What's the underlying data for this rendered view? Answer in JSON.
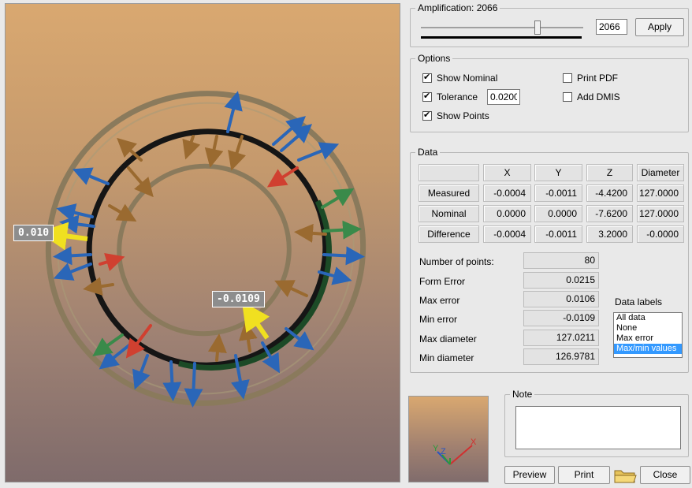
{
  "viewport": {
    "label_left": "0.010",
    "label_right": "-0.0109"
  },
  "amplification": {
    "title": "Amplification: 2066",
    "value": "2066",
    "apply_label": "Apply"
  },
  "options": {
    "title": "Options",
    "show_nominal": "Show Nominal",
    "tolerance": "Tolerance",
    "tolerance_value": "0.0200",
    "show_points": "Show Points",
    "print_pdf": "Print PDF",
    "add_dmis": "Add DMIS"
  },
  "data": {
    "title": "Data",
    "headers": [
      "",
      "X",
      "Y",
      "Z",
      "Diameter"
    ],
    "rows": [
      {
        "label": "Measured",
        "x": "-0.0004",
        "y": "-0.0011",
        "z": "-4.4200",
        "d": "127.0000"
      },
      {
        "label": "Nominal",
        "x": "0.0000",
        "y": "0.0000",
        "z": "-7.6200",
        "d": "127.0000"
      },
      {
        "label": "Difference",
        "x": "-0.0004",
        "y": "-0.0011",
        "z": "3.2000",
        "d": "-0.0000"
      }
    ],
    "stats": [
      {
        "label": "Number of points:",
        "value": "80"
      },
      {
        "label": "Form Error",
        "value": "0.0215"
      },
      {
        "label": "Max error",
        "value": "0.0106"
      },
      {
        "label": "Min error",
        "value": "-0.0109"
      },
      {
        "label": "Max diameter",
        "value": "127.0211"
      },
      {
        "label": "Min diameter",
        "value": "126.9781"
      }
    ],
    "data_labels_title": "Data labels",
    "data_labels_options": [
      "All data",
      "None",
      "Max error",
      "Max/min values"
    ]
  },
  "note": {
    "title": "Note"
  },
  "buttons": {
    "preview": "Preview",
    "print": "Print",
    "close": "Close"
  },
  "axes": {
    "x": "X",
    "y": "Y",
    "z": "Z"
  },
  "colors": {
    "selection": "#3399ff"
  }
}
